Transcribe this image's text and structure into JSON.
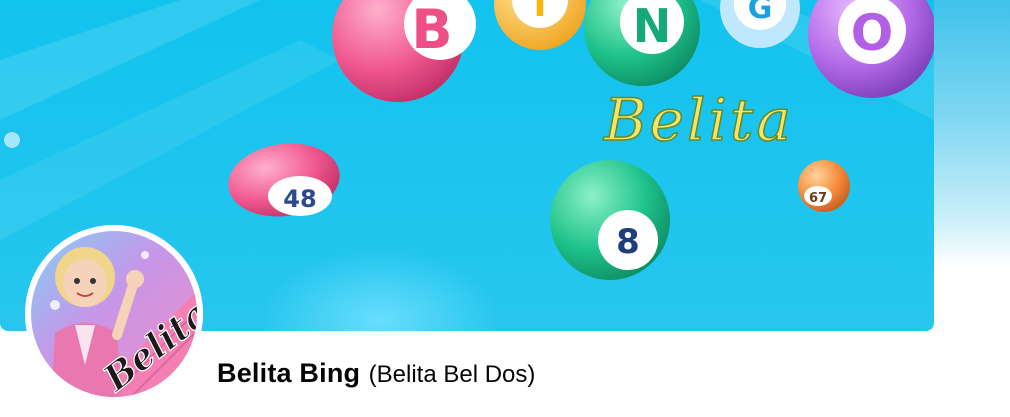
{
  "cover": {
    "logo_letters": [
      "B",
      "I",
      "N",
      "G",
      "O"
    ],
    "logo_word": "Belita",
    "ball_numbers": [
      "48",
      "8",
      "67"
    ]
  },
  "avatar": {
    "signature_text": "Belita"
  },
  "profile": {
    "name": "Belita Bing",
    "alternate_name": "(Belita Bel Dos)"
  }
}
